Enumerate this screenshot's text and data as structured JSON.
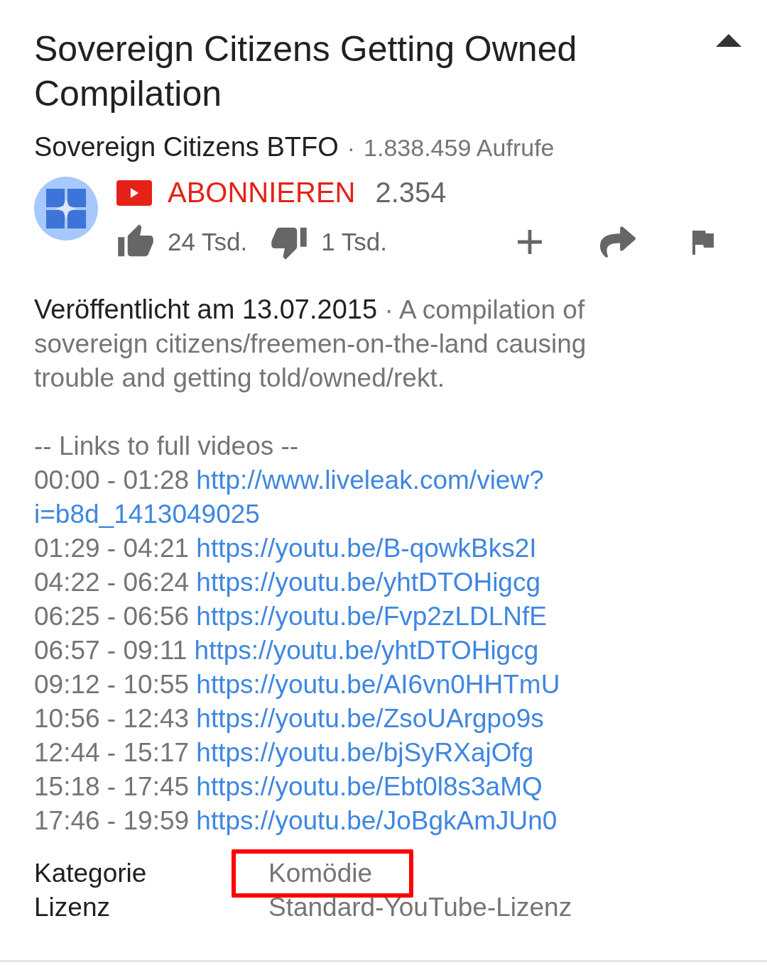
{
  "video": {
    "title": "Sovereign Citizens Getting Owned Compilation",
    "expanded": true,
    "channel": "Sovereign Citizens BTFO",
    "separator": "·",
    "views": "1.838.459 Aufrufe"
  },
  "subscribe": {
    "label": "ABONNIEREN",
    "count": "2.354"
  },
  "actions": {
    "likes": "24 Tsd.",
    "dislikes": "1 Tsd."
  },
  "description": {
    "published": "Veröffentlicht am 13.07.2015",
    "separator": "·",
    "text": "A compilation of sovereign citizens/freemen-on-the-land causing trouble and getting told/owned/rekt.",
    "links_heading": "-- Links to full videos --",
    "links": [
      {
        "time": "00:00 - 01:28",
        "url": "http://www.liveleak.com/view?i=b8d_1413049025"
      },
      {
        "time": "01:29 - 04:21",
        "url": "https://youtu.be/B-qowkBks2I"
      },
      {
        "time": "04:22 - 06:24",
        "url": "https://youtu.be/yhtDTOHigcg"
      },
      {
        "time": "06:25 - 06:56",
        "url": "https://youtu.be/Fvp2zLDLNfE"
      },
      {
        "time": "06:57 - 09:11",
        "url": "https://youtu.be/yhtDTOHigcg"
      },
      {
        "time": "09:12 - 10:55",
        "url": "https://youtu.be/AI6vn0HHTmU"
      },
      {
        "time": "10:56 - 12:43",
        "url": "https://youtu.be/ZsoUArgpo9s"
      },
      {
        "time": "12:44 - 15:17",
        "url": "https://youtu.be/bjSyRXajOfg"
      },
      {
        "time": "15:18 - 17:45",
        "url": "https://youtu.be/Ebt0l8s3aMQ"
      },
      {
        "time": "17:46 - 19:59",
        "url": "https://youtu.be/JoBgkAmJUn0"
      }
    ]
  },
  "meta": [
    {
      "label": "Kategorie",
      "value": "Komödie",
      "highlighted": true
    },
    {
      "label": "Lizenz",
      "value": "Standard-YouTube-Lizenz",
      "highlighted": false
    }
  ]
}
